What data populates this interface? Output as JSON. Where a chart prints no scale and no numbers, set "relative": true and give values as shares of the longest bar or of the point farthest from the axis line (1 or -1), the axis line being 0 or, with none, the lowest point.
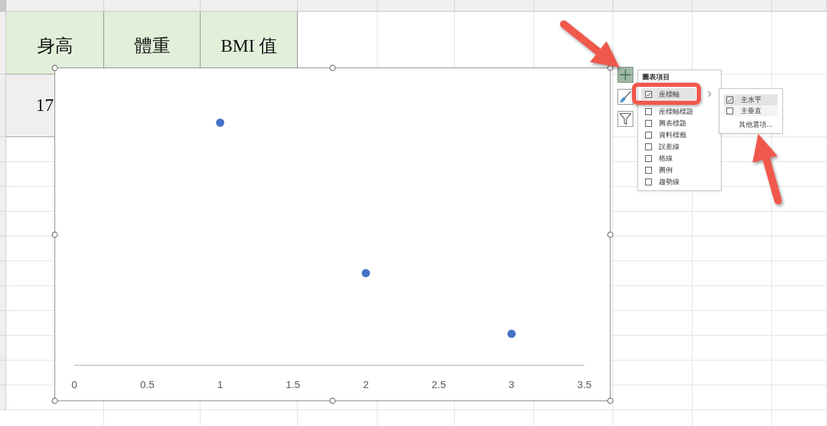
{
  "sheet": {
    "rows": [
      {
        "cells": [
          {
            "text": "身高",
            "color": "#e2efda"
          },
          {
            "text": "體重",
            "color": "#e2efda"
          },
          {
            "text": "BMI 值",
            "color": "#e2efda"
          }
        ]
      },
      {
        "cells": [
          {
            "text": "17",
            "color": "#efefef"
          }
        ]
      }
    ]
  },
  "chart": {
    "chart_data": {
      "type": "scatter",
      "x": [
        1,
        2,
        3
      ],
      "relative": true,
      "series": [
        {
          "color": "#4472c4",
          "values": [
            1,
            0.38,
            0.13
          ]
        }
      ],
      "xlim": [
        0,
        3.5
      ],
      "xticks": [
        0,
        0.5,
        1,
        1.5,
        2,
        2.5,
        3,
        3.5
      ]
    }
  },
  "chart_buttons": [
    {
      "kind": "elements",
      "selected": true
    },
    {
      "kind": "styles",
      "selected": false
    },
    {
      "kind": "filter",
      "selected": false
    }
  ],
  "chart_elements_menu": {
    "title": "圖表項目",
    "items": [
      {
        "label": "座標軸",
        "checked": true,
        "selected": true,
        "expanded": true
      },
      {
        "label": "座標軸標題",
        "checked": false,
        "selected": false,
        "expanded": false
      },
      {
        "label": "圖表標題",
        "checked": false,
        "selected": false,
        "expanded": false
      },
      {
        "label": "資料標籤",
        "checked": false,
        "selected": false,
        "expanded": false
      },
      {
        "label": "誤差線",
        "checked": false,
        "selected": false,
        "expanded": false
      },
      {
        "label": "格線",
        "checked": false,
        "selected": false,
        "expanded": false
      },
      {
        "label": "圖例",
        "checked": false,
        "selected": false,
        "expanded": false
      },
      {
        "label": "趨勢線",
        "checked": false,
        "selected": false,
        "expanded": false
      }
    ]
  },
  "axes_submenu": {
    "items": [
      {
        "label": "主水平",
        "checked": true,
        "selected": true
      },
      {
        "label": "主垂直",
        "checked": false,
        "selected": false
      }
    ],
    "more_link": "其他選項..."
  }
}
